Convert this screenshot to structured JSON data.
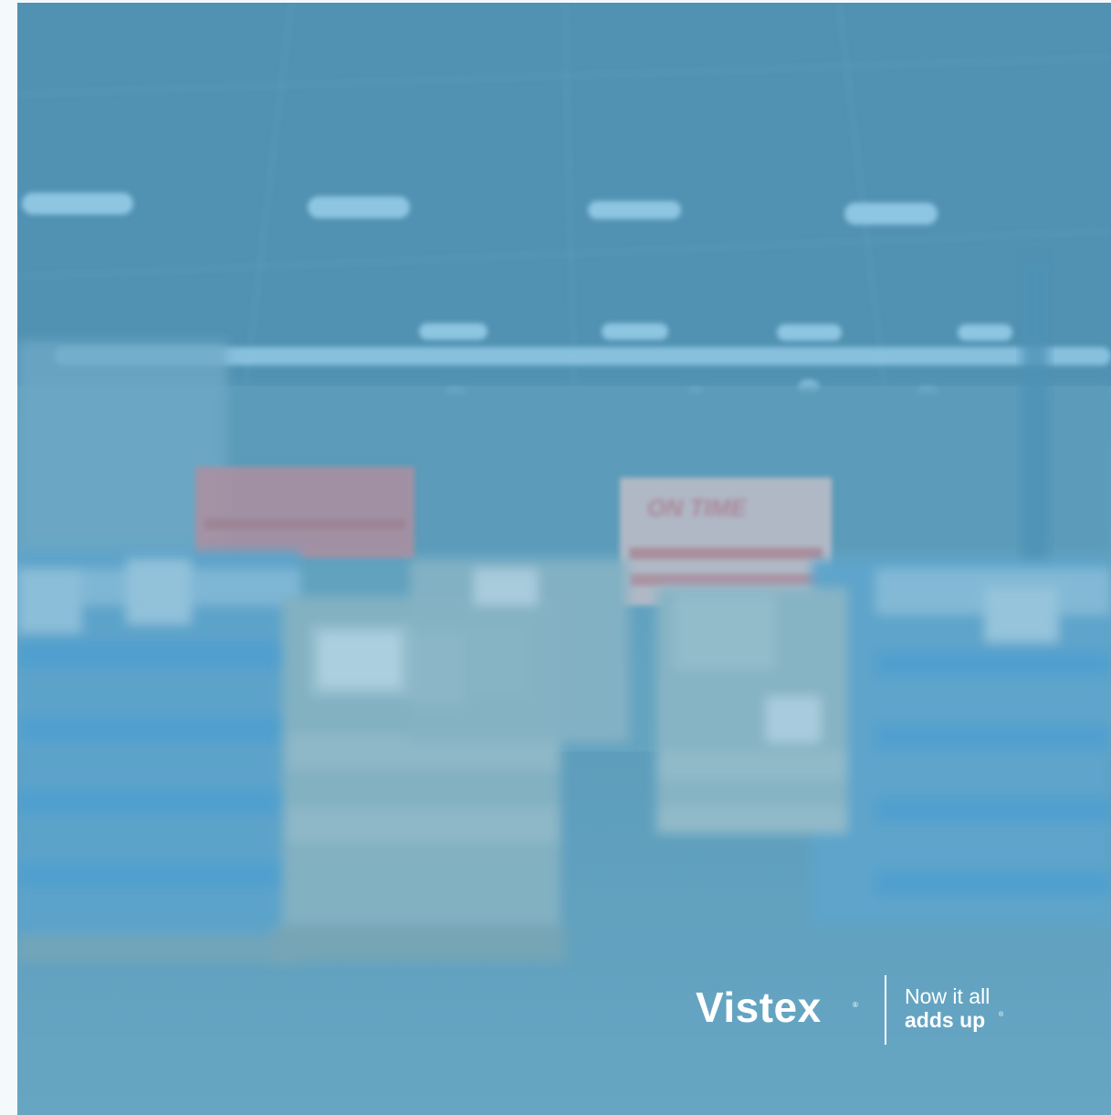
{
  "brand": {
    "name": "Vistex",
    "registered_mark": "®",
    "tagline_line1": "Now it all",
    "tagline_line2": "adds up",
    "tagline_registered_mark": "®"
  },
  "photo": {
    "description_text": "ON TIME",
    "overlay_color": "#5b9cbc"
  }
}
